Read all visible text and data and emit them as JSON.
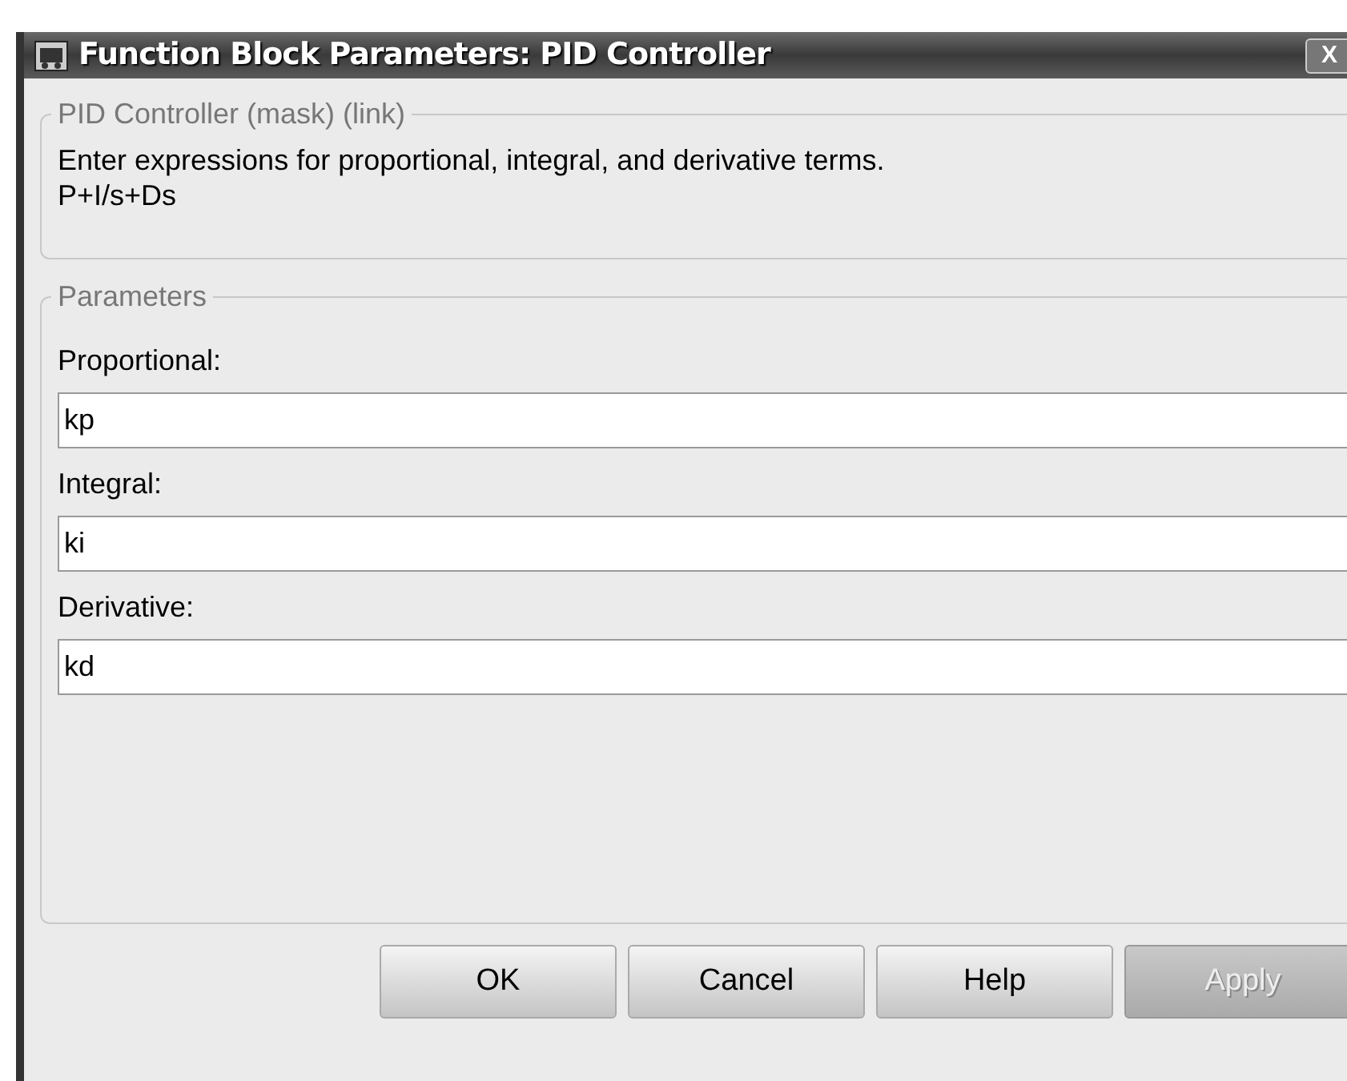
{
  "window": {
    "title": "Function Block Parameters: PID Controller",
    "close": "X"
  },
  "mask_group": {
    "title": "PID Controller (mask) (link)",
    "description": [
      "Enter expressions for proportional, integral, and derivative terms.",
      "P+I/s+Ds"
    ]
  },
  "parameters_group": {
    "title": "Parameters",
    "fields": [
      {
        "label": "Proportional:",
        "value": "kp"
      },
      {
        "label": "Integral:",
        "value": "ki"
      },
      {
        "label": "Derivative:",
        "value": "kd"
      }
    ]
  },
  "buttons": [
    {
      "label": "OK",
      "disabled": false
    },
    {
      "label": "Cancel",
      "disabled": false
    },
    {
      "label": "Help",
      "disabled": false
    },
    {
      "label": "Apply",
      "disabled": true
    }
  ]
}
